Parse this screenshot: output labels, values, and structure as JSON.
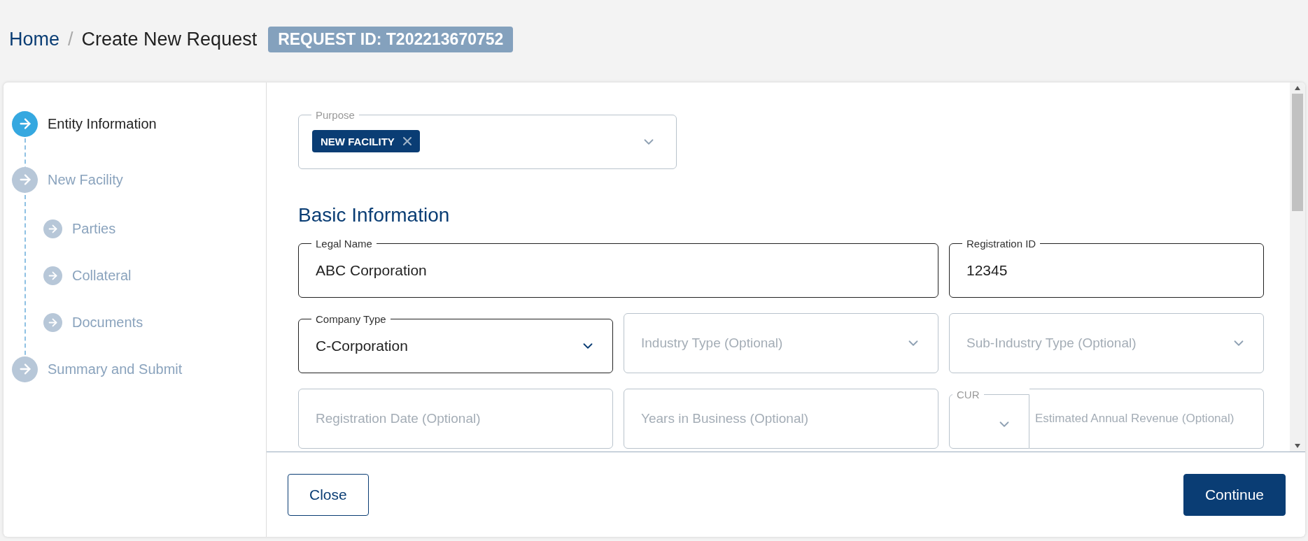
{
  "breadcrumb": [
    "Home",
    "Create New Request"
  ],
  "separator": "/",
  "request_badge": "REQUEST ID: T202213670752",
  "steps": [
    {
      "label": "Entity Information",
      "selected": true
    },
    {
      "label": "New Facility",
      "selected": false,
      "children": [
        {
          "label": "Parties",
          "selected": false
        },
        {
          "label": "Collateral",
          "selected": false
        },
        {
          "label": "Documents",
          "selected": false
        }
      ]
    },
    {
      "label": "Summary and Submit",
      "selected": false
    }
  ],
  "purpose": {
    "label": "Purpose",
    "tags": [
      "NEW FACILITY"
    ]
  },
  "section_title": "Basic Information",
  "rows": [
    [
      {
        "kind": "text",
        "label": "Legal Name",
        "value": "ABC Corporation"
      },
      {
        "kind": "text",
        "label": "Registration ID",
        "value": "12345"
      }
    ],
    [
      {
        "kind": "select",
        "label": "Company Type",
        "value": "C-Corporation"
      },
      {
        "kind": "select",
        "placeholder": "Industry Type (Optional)"
      },
      {
        "kind": "select",
        "placeholder": "Sub-Industry Type (Optional)"
      }
    ],
    [
      {
        "kind": "text",
        "placeholder": "Registration Date (Optional)"
      },
      {
        "kind": "text",
        "placeholder": "Years in Business (Optional)"
      },
      {
        "kind": "currency",
        "currency_label": "CUR",
        "placeholder": "Estimated Annual Revenue (Optional)"
      }
    ]
  ],
  "buttons": [
    {
      "label": "Close",
      "kind": "secondary"
    },
    {
      "label": "Continue",
      "kind": "primary"
    }
  ]
}
